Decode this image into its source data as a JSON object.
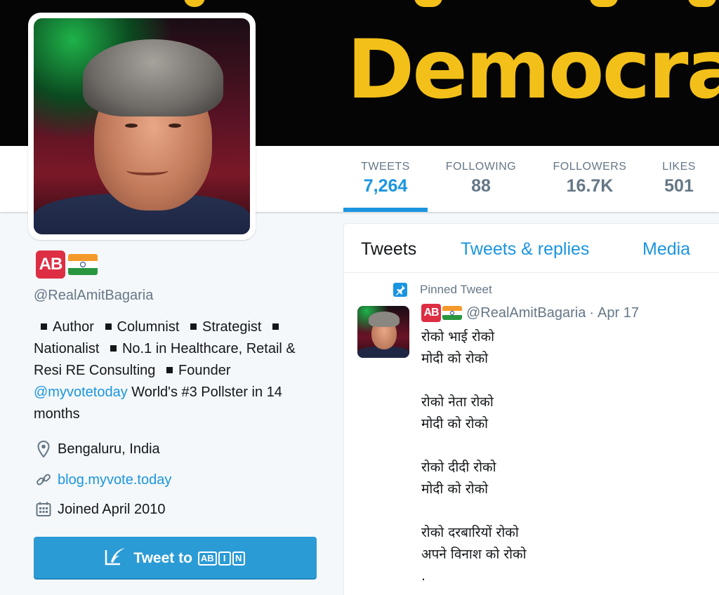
{
  "banner": {
    "text": "Democra"
  },
  "nav": {
    "stats": [
      {
        "label": "TWEETS",
        "value": "7,264"
      },
      {
        "label": "FOLLOWING",
        "value": "88"
      },
      {
        "label": "FOLLOWERS",
        "value": "16.7K"
      },
      {
        "label": "LIKES",
        "value": "501"
      }
    ]
  },
  "profile": {
    "badge_text": "AB",
    "screen_name": "@RealAmitBagaria",
    "bio": {
      "items": [
        "Author",
        "Columnist",
        "Strategist",
        "Nationalist",
        "No.1 in Healthcare, Retail & Resi RE Consulting",
        "Founder"
      ],
      "link": "@myvotetoday",
      "tail": "World's #3 Pollster in 14 months"
    },
    "location": "Bengaluru, India",
    "website": "blog.myvote.today",
    "joined": "Joined April 2010",
    "tweet_to_button": {
      "label": "Tweet to",
      "badges": [
        "AB",
        "I",
        "N"
      ]
    }
  },
  "timeline": {
    "tabs": [
      "Tweets",
      "Tweets & replies",
      "Media"
    ],
    "pinned_label": "Pinned Tweet",
    "tweet": {
      "badge_text": "AB",
      "handle": "@RealAmitBagaria",
      "separator": "·",
      "date": "Apr 17",
      "text": "रोको भाई रोको\nमोदी को रोको\n\nरोको नेता रोको\nमोदी को रोको\n\nरोको दीदी रोको\nमोदी को रोको\n\nरोको दरबारियों रोको\nअपने विनाश को रोको\n."
    }
  },
  "colors": {
    "accent": "#1b95e0",
    "banner_text": "#f3c019",
    "badge_red": "#dd2e44",
    "button": "#2b9bd6"
  },
  "icons": {
    "location": "map-pin-icon",
    "website": "link-icon",
    "joined": "calendar-icon",
    "tweet_to": "quill-icon",
    "pinned": "pin-icon"
  }
}
